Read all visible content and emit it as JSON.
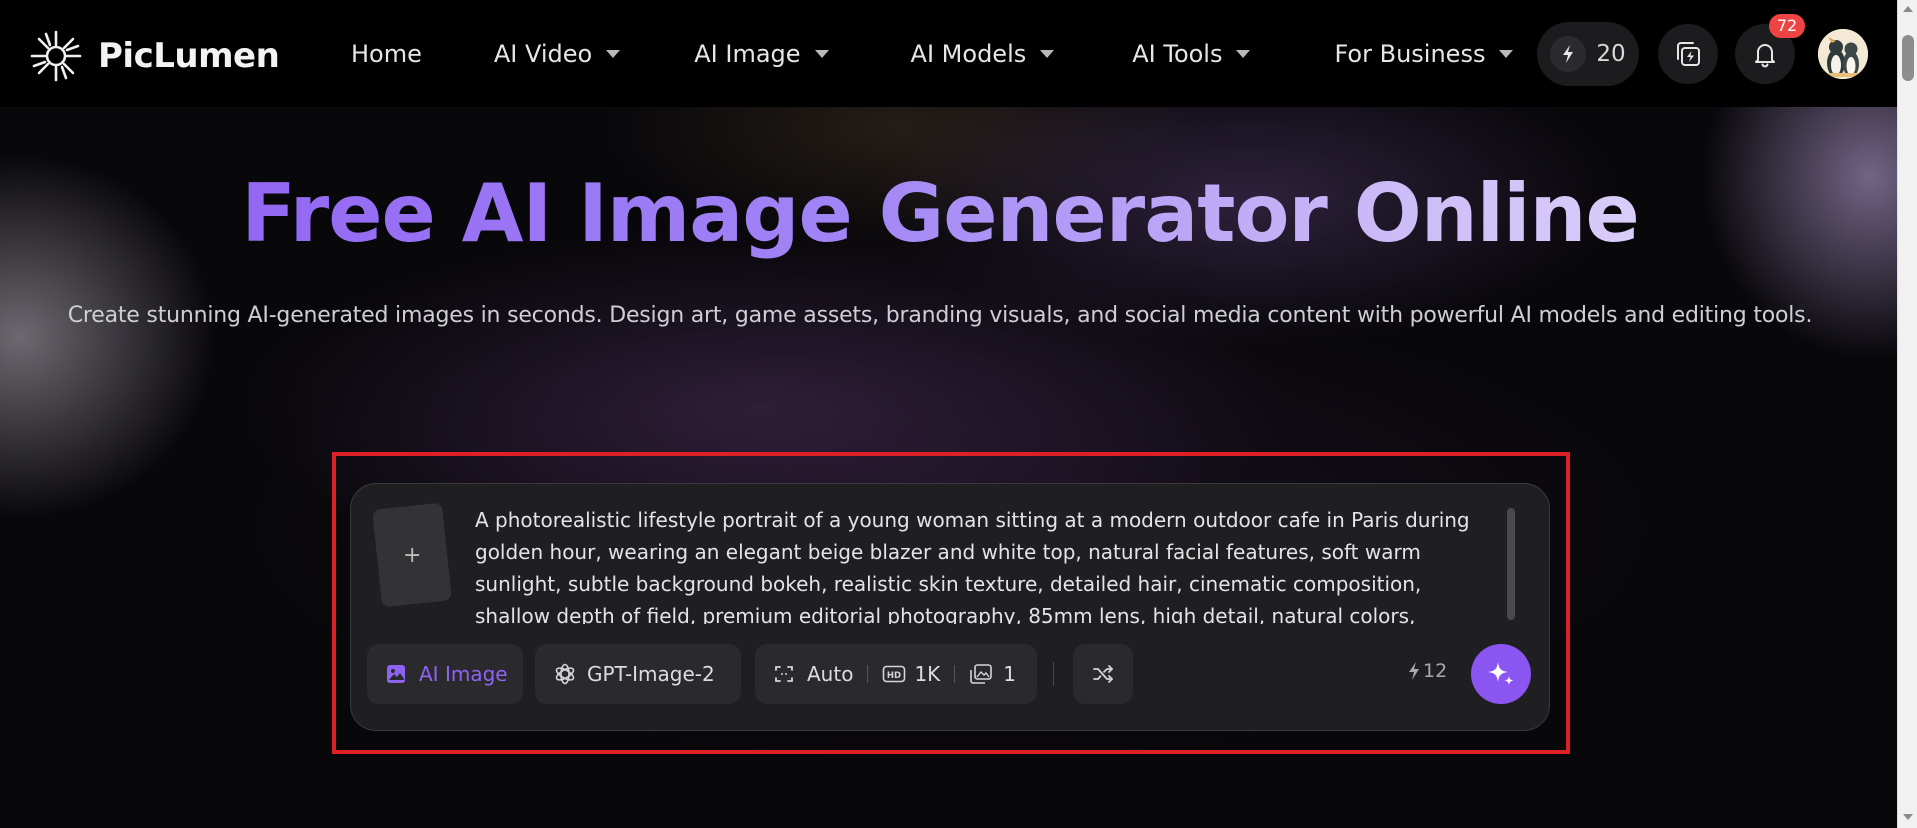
{
  "brand": {
    "name": "PicLumen"
  },
  "nav": {
    "items": [
      {
        "label": "Home",
        "has_dropdown": false
      },
      {
        "label": "AI Video",
        "has_dropdown": true
      },
      {
        "label": "AI Image",
        "has_dropdown": true
      },
      {
        "label": "AI Models",
        "has_dropdown": true
      },
      {
        "label": "AI Tools",
        "has_dropdown": true
      },
      {
        "label": "For Business",
        "has_dropdown": true
      }
    ]
  },
  "header": {
    "credits": "20",
    "credits_icon": "lightning-icon",
    "notification_count": "72"
  },
  "hero": {
    "title": "Free AI Image Generator Online",
    "subtitle": "Create stunning AI-generated images in seconds. Design art, game assets, branding visuals, and social media content with powerful AI models and editing tools."
  },
  "prompt": {
    "upload_label": "+",
    "text": "A photorealistic lifestyle portrait of a young woman sitting at a modern outdoor cafe in Paris during golden hour, wearing an elegant beige blazer and white top, natural facial features, soft warm sunlight, subtle background bokeh, realistic skin texture, detailed hair, cinematic composition, shallow depth of field, premium editorial photography, 85mm lens, high detail, natural colors, realistic proportions.",
    "mode_label": "AI Image",
    "model_label": "GPT-Image-2",
    "aspect_label": "Auto",
    "resolution_label": "1K",
    "count_label": "1",
    "cost": "12"
  },
  "colors": {
    "accent": "#8a55f0",
    "active_chip_text": "#8f63f2",
    "highlight_border": "#dd1f26",
    "badge": "#ef4444"
  }
}
